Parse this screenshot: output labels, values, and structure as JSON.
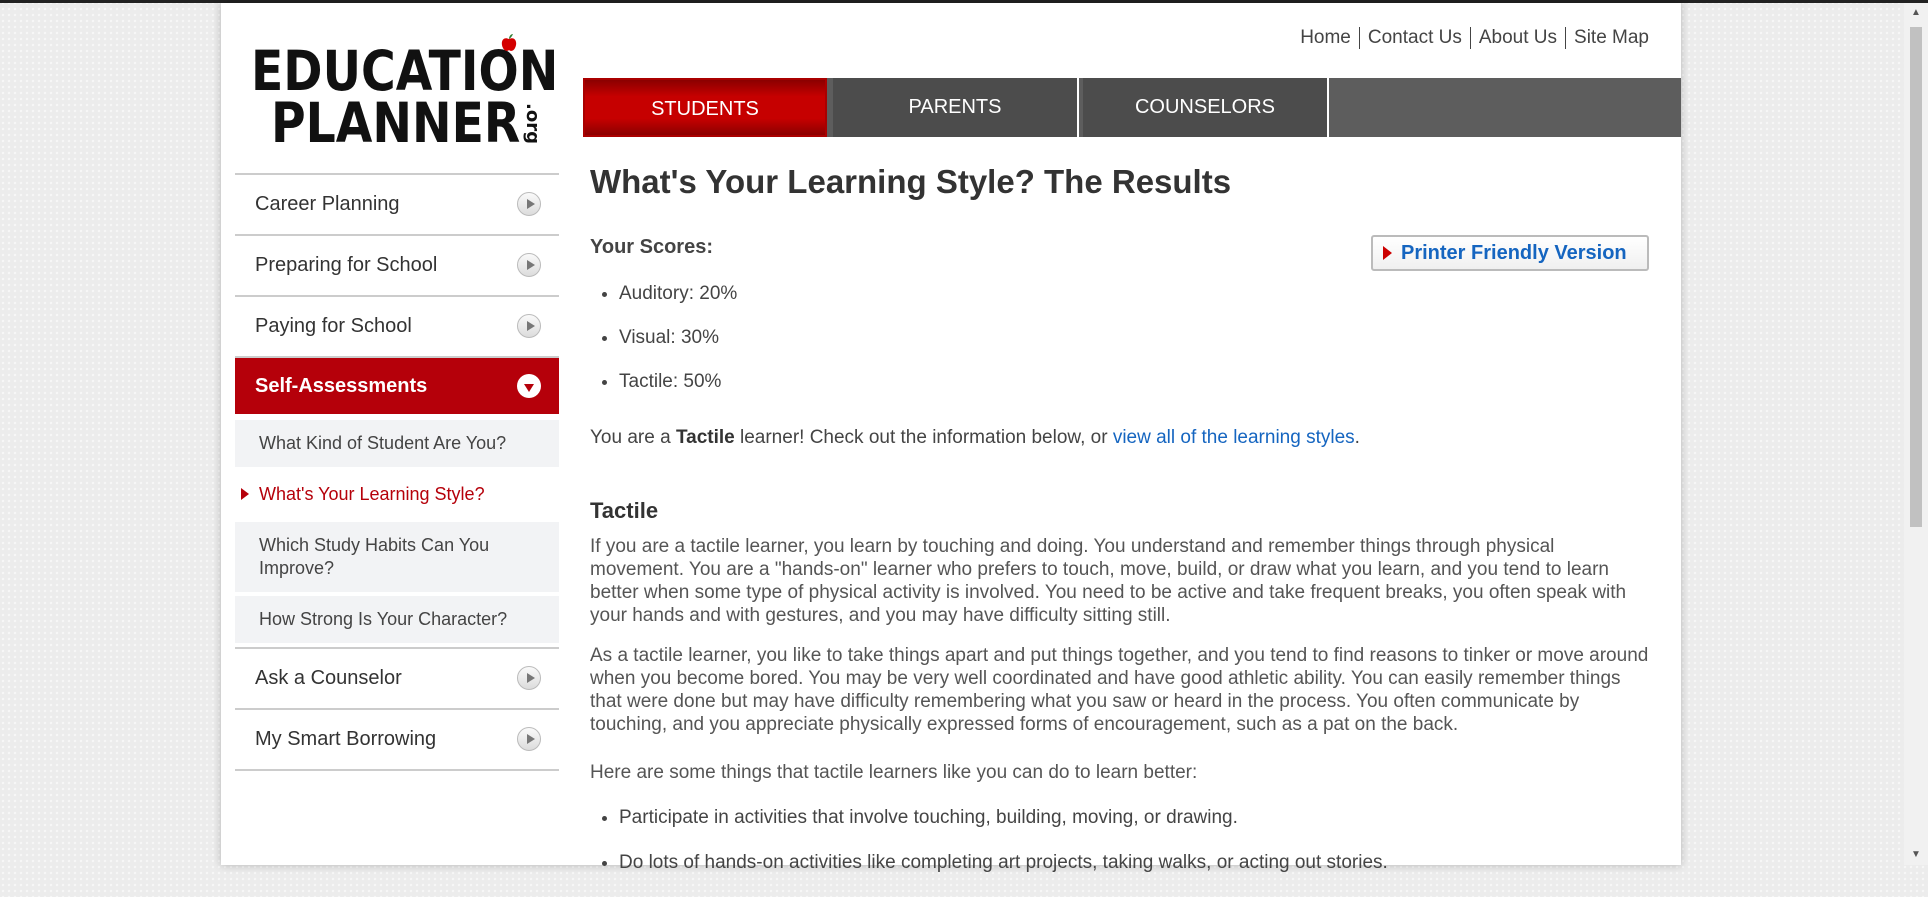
{
  "logo": {
    "line1": "EDUCATION",
    "line2": "PLANNER",
    "suffix": ".org",
    "tm": "™"
  },
  "utility_nav": [
    "Home",
    "Contact Us",
    "About Us",
    "Site Map"
  ],
  "tabs": [
    {
      "label": "STUDENTS",
      "active": true
    },
    {
      "label": "PARENTS",
      "active": false
    },
    {
      "label": "COUNSELORS",
      "active": false
    }
  ],
  "sidebar": {
    "items_top": [
      "Career Planning",
      "Preparing for School",
      "Paying for School"
    ],
    "active_section": "Self-Assessments",
    "sub_items": [
      "What Kind of Student Are You?",
      "What's Your Learning Style?",
      "Which Study Habits Can You Improve?",
      "How Strong Is Your Character?"
    ],
    "current_sub_index": 1,
    "items_bottom": [
      "Ask a Counselor",
      "My Smart Borrowing"
    ]
  },
  "main": {
    "title": "What's Your Learning Style? The Results",
    "scores_label": "Your Scores:",
    "printer_button": "Printer Friendly Version",
    "scores": [
      "Auditory: 20%",
      "Visual: 30%",
      "Tactile: 50%"
    ],
    "result_prefix": "You are a ",
    "result_style": "Tactile",
    "result_middle": " learner! Check out the information below, or ",
    "result_link": "view all of the learning styles",
    "result_end": ".",
    "section_title": "Tactile",
    "paragraph1": "If you are a tactile learner, you learn by touching and doing. You understand and remember things through physical movement. You are a \"hands-on\" learner who prefers to touch, move, build, or draw what you learn, and you tend to learn better when some type of physical activity is involved. You need to be active and take frequent breaks, you often speak with your hands and with gestures, and you may have difficulty sitting still.",
    "paragraph2": "As a tactile learner, you like to take things apart and put things together, and you tend to find reasons to tinker or move around when you become bored. You may be very well coordinated and have good athletic ability. You can easily remember things that were done but may have difficulty remembering what you saw or heard in the process. You often communicate by touching, and you appreciate physically expressed forms of encouragement, such as a pat on the back.",
    "paragraph3": "Here are some things that tactile learners like you can do to learn better:",
    "tips": [
      "Participate in activities that involve touching, building, moving, or drawing.",
      "Do lots of hands-on activities like completing art projects, taking walks, or acting out stories."
    ]
  },
  "colors": {
    "brand_red": "#b5000a",
    "link_blue": "#1565c0",
    "tab_gray": "#4c4c4c"
  }
}
